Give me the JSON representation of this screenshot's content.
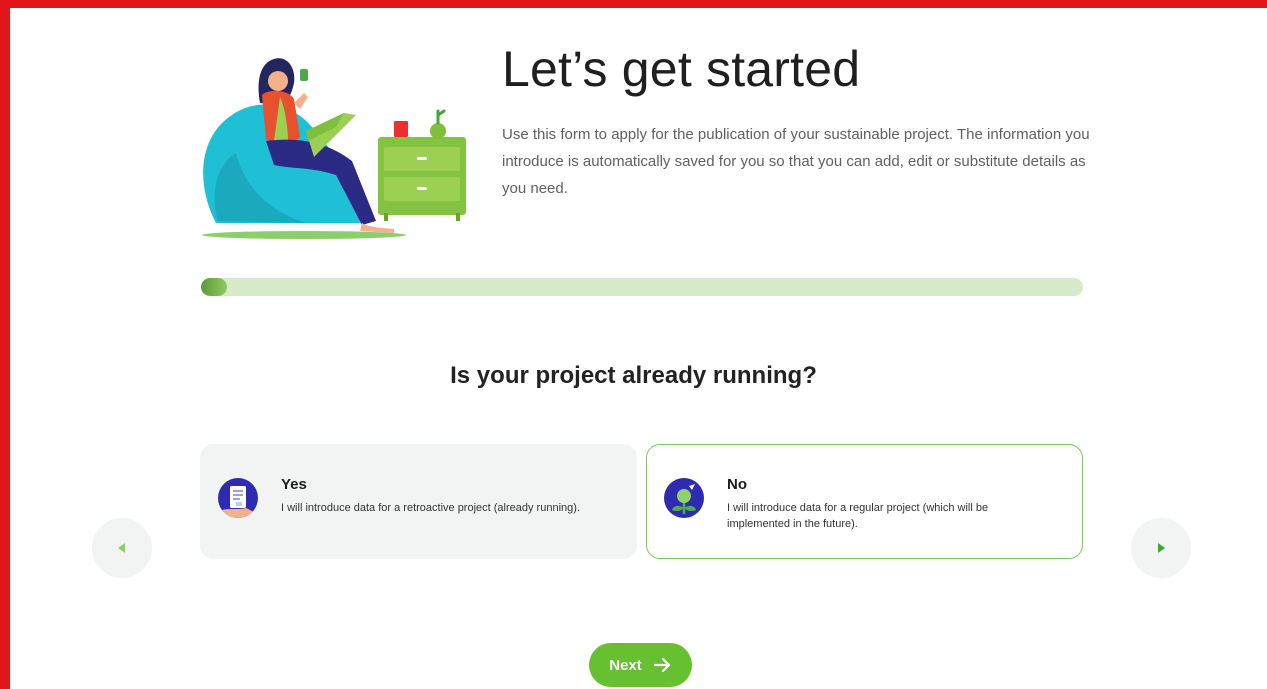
{
  "hero": {
    "title": "Let’s get started",
    "intro": "Use this form to apply for the publication of your sustainable project. The information you introduce is automatically saved for you so that you can add, edit or substitute details as you need.",
    "illustration_icon": "woman-beanbag-laptop-illustration"
  },
  "progress": {
    "fraction": 0.03,
    "color": "#5b9a3a"
  },
  "question": "Is your project already running?",
  "options": [
    {
      "title": "Yes",
      "description": "I will introduce data for a retroactive project (already running).",
      "icon": "document-icon",
      "selected": false
    },
    {
      "title": "No",
      "description": "I will introduce data for a regular project (which will be implemented in the future).",
      "icon": "plant-sprout-icon",
      "selected": true
    }
  ],
  "nav": {
    "prev_icon": "triangle-left-icon",
    "next_icon": "triangle-right-icon"
  },
  "next_button": {
    "label": "Next",
    "icon": "arrow-right-icon"
  },
  "colors": {
    "accent": "#66c02f",
    "frame": "#e0161b",
    "icon_bg": "#2f2bb0",
    "progress_track": "#d6ebc9"
  }
}
